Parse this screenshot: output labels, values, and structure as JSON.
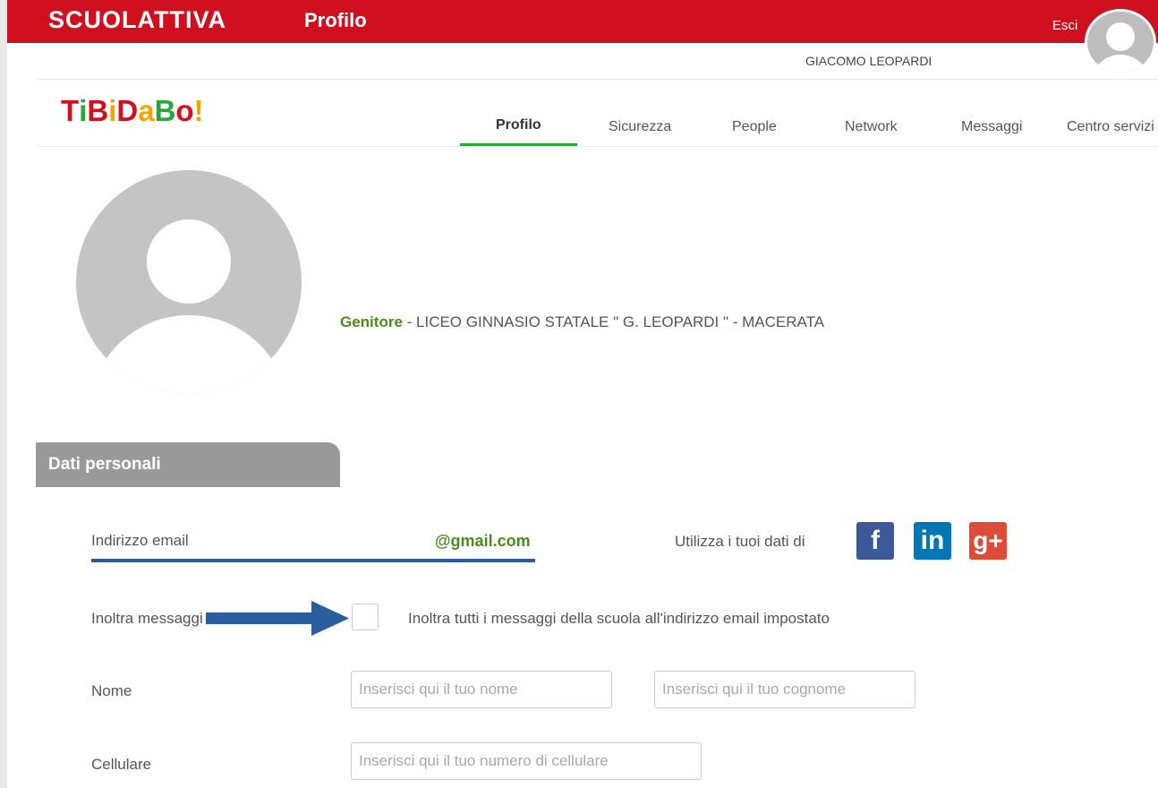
{
  "header": {
    "brand": "SCUOLATTIVA",
    "app_title": "Profilo",
    "logout_label": "Esci",
    "user_name": "GIACOMO LEOPARDI"
  },
  "nav": {
    "logo_text": "TiBiDaBo!",
    "tabs": [
      {
        "label": "Profilo",
        "active": true
      },
      {
        "label": "Sicurezza"
      },
      {
        "label": "People"
      },
      {
        "label": "Network"
      },
      {
        "label": "Messaggi"
      },
      {
        "label": "Centro servizi"
      }
    ]
  },
  "profile": {
    "role": "Genitore",
    "role_sep": " - ",
    "school": "LICEO GINNASIO STATALE \" G. LEOPARDI \" - MACERATA"
  },
  "section": {
    "title": "Dati personali"
  },
  "form": {
    "email_label": "Indirizzo email",
    "email_value": "@gmail.com",
    "social_label": "Utilizza i tuoi dati di",
    "forward_label": "Inoltra messaggi",
    "forward_text": "Inoltra tutti i messaggi della scuola all'indirizzo email impostato",
    "nome_label": "Nome",
    "nome_placeholder": "Inserisci qui il tuo nome",
    "cognome_placeholder": "Inserisci qui il tuo cognome",
    "cellulare_label": "Cellulare",
    "cellulare_placeholder": "Inserisci qui il tuo numero di cellulare"
  },
  "colors": {
    "header_red": "#d0101e",
    "green": "#4d8a1c",
    "annotation_blue": "#2a5d9b"
  }
}
